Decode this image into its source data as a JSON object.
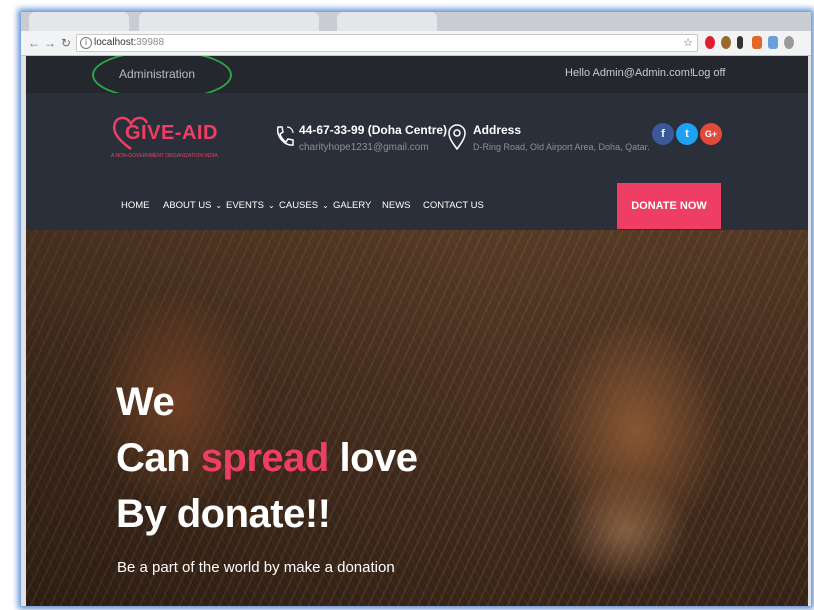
{
  "browser": {
    "url_host": "localhost:",
    "url_port": "39988"
  },
  "topbar": {
    "admin_link": "Administration",
    "greeting": "Hello Admin@Admin.com!",
    "logout": "Log off"
  },
  "brand": {
    "logo_text": "GIVE-AID",
    "tagline": "A NON-GOVERNMENT ORGANIZATION INDIA",
    "accent_color": "#ef3e63"
  },
  "contact": {
    "phone_title": "44-67-33-99 (Doha Centre)",
    "email": "charityhope1231@gmail.com",
    "address_title": "Address",
    "address": "D-Ring Road, Old Airport Area, Doha, Qatar."
  },
  "social": {
    "facebook": "f",
    "twitter": "t",
    "google": "G+"
  },
  "nav": {
    "items": [
      "HOME",
      "ABOUT US",
      "EVENTS",
      "CAUSES",
      "GALERY",
      "NEWS",
      "CONTACT US"
    ],
    "donate": "DONATE NOW"
  },
  "hero": {
    "line1": "We",
    "line2_a": "Can ",
    "line2_accent": "spread",
    "line2_b": " love",
    "line3": "By donate!!",
    "subtitle": "Be a part of the world by make a donation"
  }
}
